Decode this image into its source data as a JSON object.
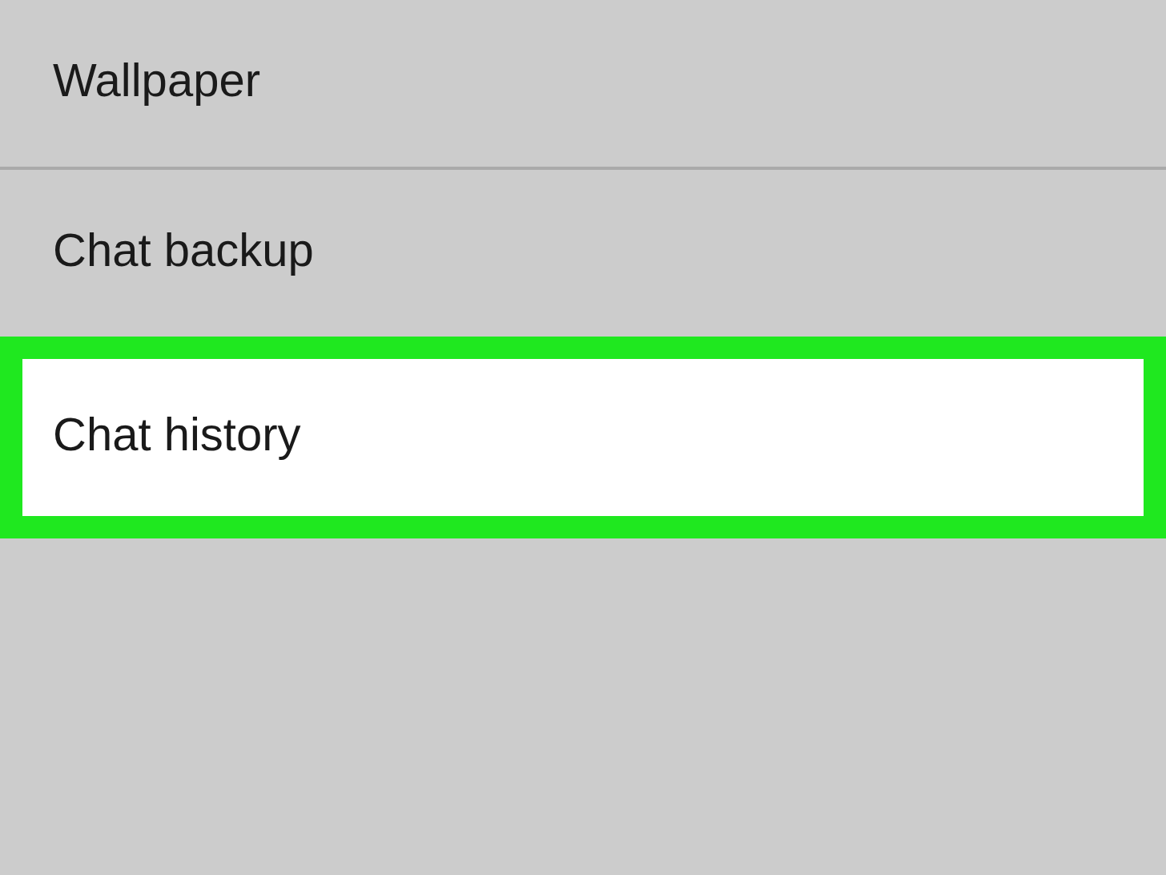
{
  "items": [
    {
      "label": "Wallpaper",
      "selected": false
    },
    {
      "label": "Chat backup",
      "selected": false
    },
    {
      "label": "Chat history",
      "selected": true
    }
  ]
}
